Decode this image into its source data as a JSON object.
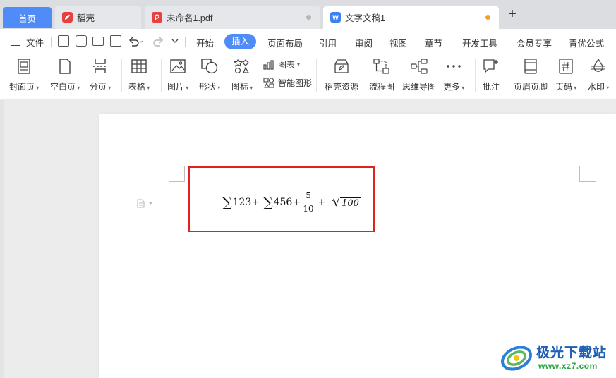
{
  "tabs": {
    "home": "首页",
    "docer": "稻壳",
    "pdf": "未命名1.pdf",
    "doc": "文字文稿1",
    "doc_unsaved_color": "#f0a02a",
    "pdf_dot_color": "#b5b5b5",
    "add": "+"
  },
  "menu": {
    "file": "文件",
    "items": [
      "开始",
      "插入",
      "页面布局",
      "引用",
      "审阅",
      "视图",
      "章节",
      "开发工具",
      "会员专享",
      "青优公式"
    ],
    "active": "插入",
    "accent": "#4f8cf7"
  },
  "ribbon": {
    "cover_page": "封面页",
    "blank_page": "空白页",
    "page_break": "分页",
    "table": "表格",
    "picture": "图片",
    "shape": "形状",
    "icon": "图标",
    "chart": "图表",
    "smart_art": "智能图形",
    "docer_resources": "稻壳资源",
    "flowchart": "流程图",
    "mind_map": "思维导图",
    "more": "更多",
    "comment": "批注",
    "header_footer": "页眉页脚",
    "page_number": "页码",
    "watermark": "水印"
  },
  "formula": {
    "sigma": "∑",
    "term1": "123+",
    "term2": "456+",
    "numerator": "5",
    "denominator": "10",
    "plus": "+",
    "root_index": "2",
    "radical": "√",
    "radicand": "100"
  },
  "highlight_color": "#e0211d",
  "watermark": {
    "title": "极光下载站",
    "url": "www.xz7.com"
  }
}
